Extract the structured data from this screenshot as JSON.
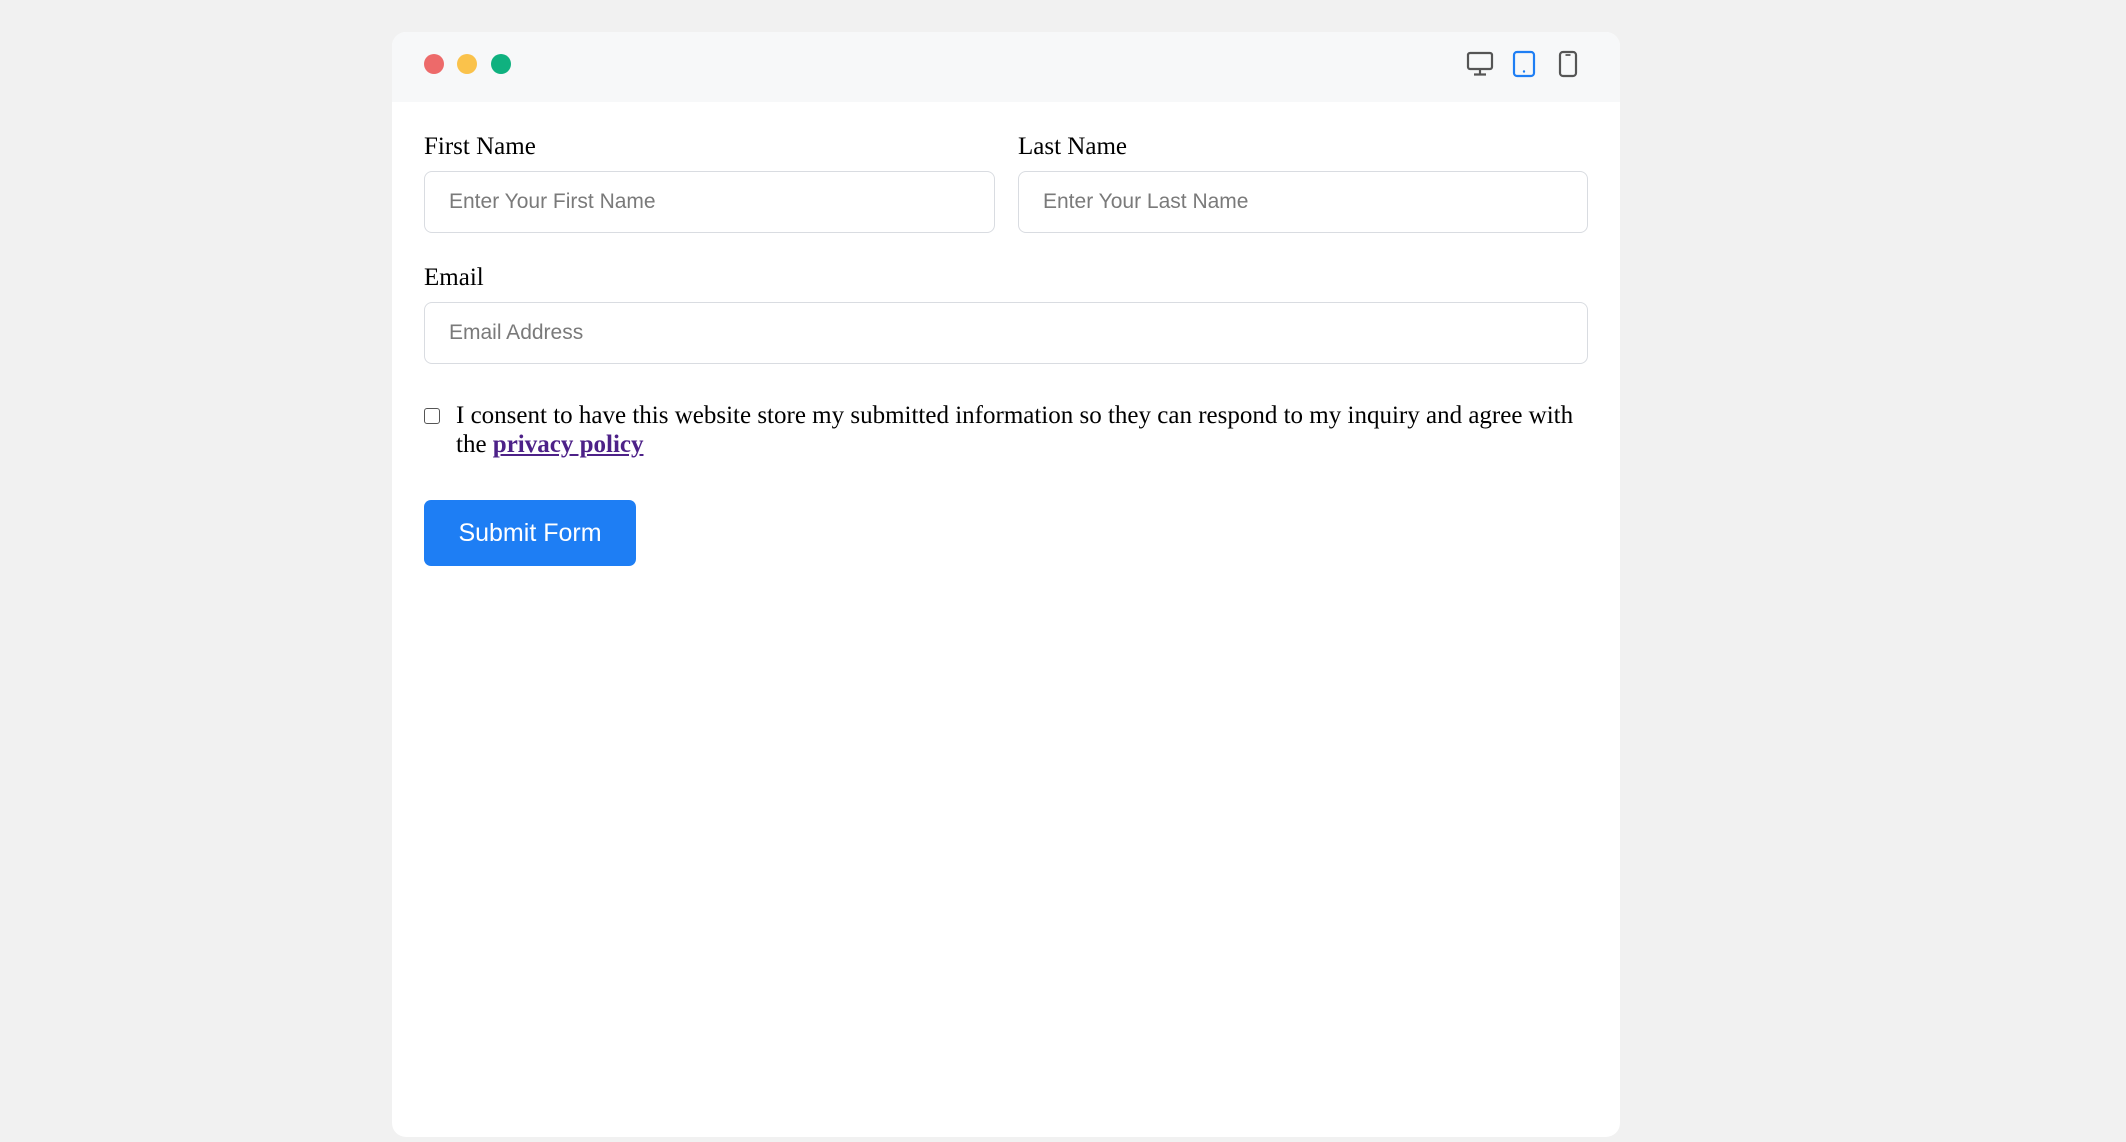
{
  "window": {
    "controls": {
      "close_color": "#ed6a6a",
      "minimize_color": "#fac24b",
      "maximize_color": "#0fb17f"
    },
    "device_toggle": {
      "items": [
        {
          "icon": "desktop-icon",
          "active": false
        },
        {
          "icon": "tablet-icon",
          "active": true
        },
        {
          "icon": "mobile-icon",
          "active": false
        }
      ],
      "active_color": "#1e7ef4"
    }
  },
  "form": {
    "first_name": {
      "label": "First Name",
      "value": "",
      "placeholder": "Enter Your First Name"
    },
    "last_name": {
      "label": "Last Name",
      "value": "",
      "placeholder": "Enter Your Last Name"
    },
    "email": {
      "label": "Email",
      "value": "",
      "placeholder": "Email Address"
    },
    "consent": {
      "checked": false,
      "text": "I consent to have this website store my submitted information so they can respond to my inquiry and agree with the",
      "link_text": "privacy policy"
    },
    "submit_label": "Submit Form",
    "submit_color": "#1e7ef4"
  }
}
